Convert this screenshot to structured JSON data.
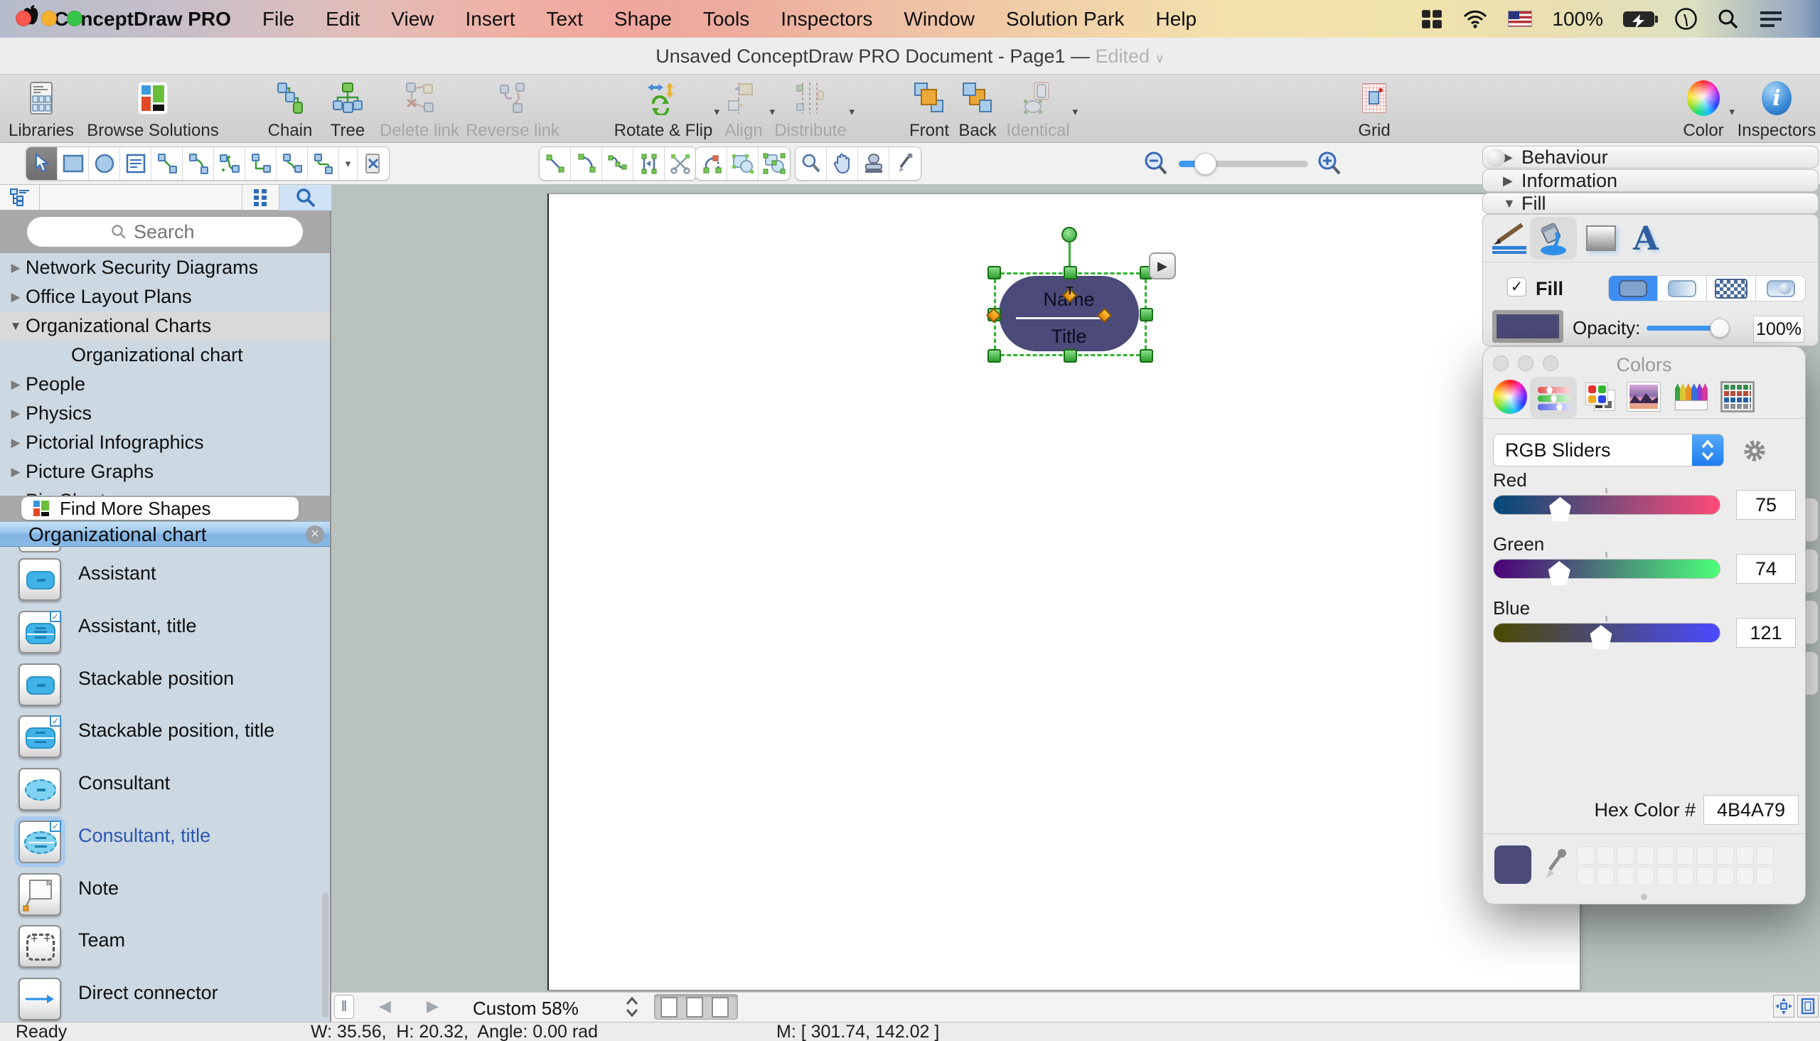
{
  "menu_bar": {
    "app_name": "ConceptDraw PRO",
    "items": [
      "File",
      "Edit",
      "View",
      "Insert",
      "Text",
      "Shape",
      "Tools",
      "Inspectors",
      "Window",
      "Solution Park",
      "Help"
    ],
    "battery_level": "100%"
  },
  "title_bar": {
    "title": "Unsaved ConceptDraw PRO Document - Page1 —",
    "edited_badge": "Edited"
  },
  "toolbar": {
    "items": [
      {
        "label": "Libraries",
        "enabled": true
      },
      {
        "label": "Browse Solutions",
        "enabled": true
      },
      {
        "label": "Chain",
        "enabled": true
      },
      {
        "label": "Tree",
        "enabled": true
      },
      {
        "label": "Delete link",
        "enabled": false
      },
      {
        "label": "Reverse link",
        "enabled": false
      },
      {
        "label": "Rotate & Flip",
        "enabled": true
      },
      {
        "label": "Align",
        "enabled": false
      },
      {
        "label": "Distribute",
        "enabled": false
      },
      {
        "label": "Front",
        "enabled": true
      },
      {
        "label": "Back",
        "enabled": true
      },
      {
        "label": "Identical",
        "enabled": false
      },
      {
        "label": "Grid",
        "enabled": true
      },
      {
        "label": "Color",
        "enabled": true
      },
      {
        "label": "Inspectors",
        "enabled": true
      }
    ]
  },
  "sidebar": {
    "search_placeholder": "Search",
    "tree": [
      {
        "label": "Network Security Diagrams",
        "state": "collapsed"
      },
      {
        "label": "Office Layout Plans",
        "state": "collapsed"
      },
      {
        "label": "Organizational Charts",
        "state": "expanded",
        "selected": true
      },
      {
        "label": "Organizational chart",
        "child": true
      },
      {
        "label": "People",
        "state": "collapsed"
      },
      {
        "label": "Physics",
        "state": "collapsed"
      },
      {
        "label": "Pictorial Infographics",
        "state": "collapsed"
      },
      {
        "label": "Picture Graphs",
        "state": "collapsed"
      },
      {
        "label": "Pie Charts",
        "state": "collapsed"
      }
    ],
    "find_more_label": "Find More Shapes",
    "panel_title": "Organizational chart",
    "shapes": [
      {
        "label": "Assistant"
      },
      {
        "label": "Assistant, title"
      },
      {
        "label": "Stackable position"
      },
      {
        "label": "Stackable position, title"
      },
      {
        "label": "Consultant"
      },
      {
        "label": "Consultant, title",
        "selected": true
      },
      {
        "label": "Note"
      },
      {
        "label": "Team"
      },
      {
        "label": "Direct connector"
      }
    ]
  },
  "canvas": {
    "shape": {
      "name_text": "Name",
      "title_text": "Title",
      "fill": "#4B4A79"
    },
    "page_bar": {
      "zoom_label": "Custom 58%"
    }
  },
  "status_bar": {
    "ready": "Ready",
    "dimensions": "W: 35.56,  H: 20.32,  Angle: 0.00 rad",
    "mouse": "M: [ 301.74, 142.02 ]"
  },
  "inspector": {
    "sections": {
      "behaviour": "Behaviour",
      "information": "Information",
      "fill": "Fill"
    },
    "fill_checkbox_label": "Fill",
    "opacity_label": "Opacity:",
    "opacity_value": "100%",
    "opacity_pct": "92%",
    "fill_color": "#4B4A79"
  },
  "colors": {
    "window_title": "Colors",
    "mode_dropdown": "RGB Sliders",
    "sliders": [
      {
        "label": "Red",
        "value": "75",
        "pct": "29.4%"
      },
      {
        "label": "Green",
        "value": "74",
        "pct": "29.0%"
      },
      {
        "label": "Blue",
        "value": "121",
        "pct": "47.5%"
      }
    ],
    "hex_label": "Hex Color #",
    "hex_value": "4B4A79",
    "current_color": "#4B4A79"
  },
  "glyphs": {
    "disclosure_closed": "▶",
    "disclosure_open": "▼",
    "caret_down": "▾",
    "chevron_down": "∨",
    "close": "×",
    "play": "▶",
    "pause": "‖",
    "page_prev": "◀",
    "page_next": "▶",
    "check": "✓",
    "text_handle": "T"
  }
}
